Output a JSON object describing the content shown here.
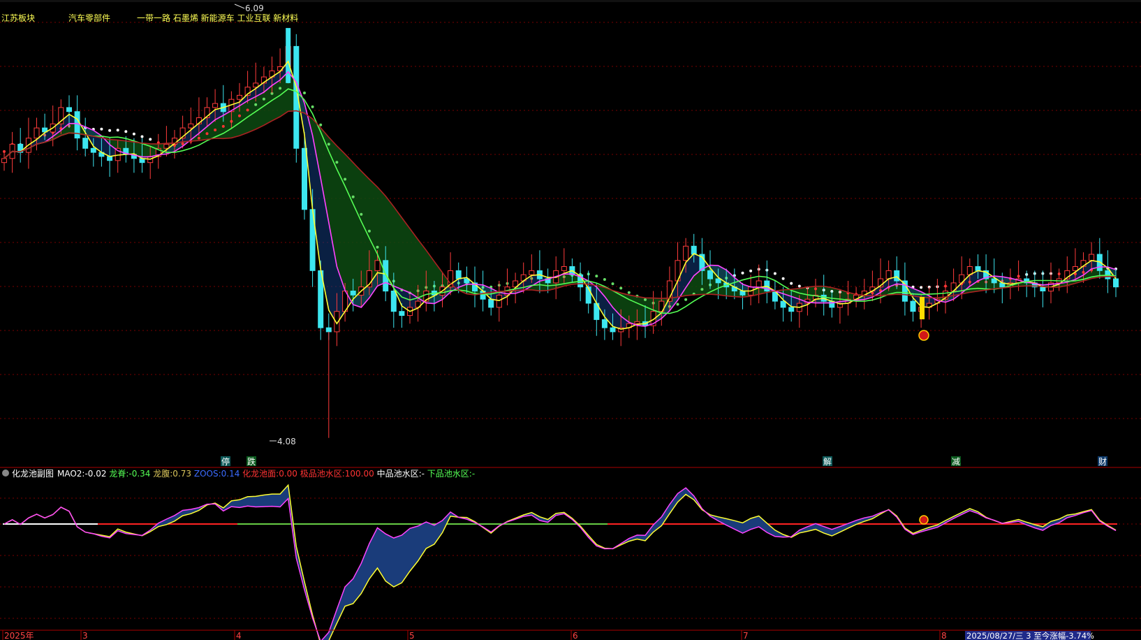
{
  "header": {
    "sectors": [
      "江苏板块",
      "汽车零部件",
      "一带一路 石墨烯 新能源车 工业互联 新材料"
    ]
  },
  "main_chart": {
    "high_label": "6.09",
    "low_label": "4.08",
    "event_tags": [
      "停",
      "跌",
      "解",
      "减",
      "财"
    ]
  },
  "sub_chart": {
    "title": "化龙池副图",
    "indicators": [
      {
        "label": "MAO2:",
        "value": "-0.02",
        "color": "#ffffff"
      },
      {
        "label": "龙脊:",
        "value": "-0.34",
        "color": "#55ff55"
      },
      {
        "label": "龙腹:",
        "value": "0.73",
        "color": "#d9c45a"
      },
      {
        "label": "ZOOS:",
        "value": "0.14",
        "color": "#3b6bff"
      },
      {
        "label": "化龙池面:",
        "value": "0.00",
        "color": "#ff3333"
      },
      {
        "label": "极品池水区:",
        "value": "100.00",
        "color": "#ff3333"
      },
      {
        "label": "中品池水区:",
        "value": "-",
        "color": "#ffffff"
      },
      {
        "label": "下品池水区:",
        "value": "-",
        "color": "#55ff55"
      }
    ]
  },
  "time_axis": {
    "labels": [
      "2025年",
      "3",
      "4",
      "5",
      "6",
      "7",
      "8"
    ],
    "status": "2025/08/27/三 3 至今涨幅-3.74%"
  },
  "chart_data": [
    {
      "type": "candlestick",
      "title": "",
      "ylabel": "",
      "xlabel": "",
      "high": 6.09,
      "low": 4.08,
      "ylim": [
        4.0,
        6.2
      ],
      "x_labels": [
        "2025年",
        "3",
        "4",
        "5",
        "6",
        "7",
        "8"
      ],
      "closes": [
        5.45,
        5.52,
        5.48,
        5.55,
        5.6,
        5.58,
        5.62,
        5.7,
        5.68,
        5.55,
        5.5,
        5.48,
        5.46,
        5.44,
        5.5,
        5.47,
        5.45,
        5.43,
        5.46,
        5.5,
        5.52,
        5.55,
        5.6,
        5.62,
        5.65,
        5.7,
        5.72,
        5.68,
        5.74,
        5.76,
        5.8,
        5.82,
        5.85,
        5.88,
        5.9,
        6.0,
        5.5,
        5.2,
        4.9,
        4.62,
        4.6,
        4.7,
        4.8,
        4.78,
        4.82,
        4.9,
        4.95,
        4.8,
        4.7,
        4.68,
        4.72,
        4.75,
        4.8,
        4.78,
        4.82,
        4.9,
        4.86,
        4.84,
        4.8,
        4.76,
        4.72,
        4.78,
        4.82,
        4.85,
        4.88,
        4.9,
        4.86,
        4.84,
        4.9,
        4.92,
        4.88,
        4.82,
        4.74,
        4.66,
        4.62,
        4.6,
        4.62,
        4.64,
        4.65,
        4.63,
        4.7,
        4.75,
        4.85,
        4.95,
        5.02,
        4.98,
        4.9,
        4.86,
        4.84,
        4.82,
        4.8,
        4.78,
        4.82,
        4.85,
        4.8,
        4.75,
        4.72,
        4.7,
        4.74,
        4.76,
        4.78,
        4.75,
        4.72,
        4.74,
        4.76,
        4.78,
        4.8,
        4.82,
        4.86,
        4.9,
        4.85,
        4.75,
        4.7,
        4.72,
        4.74,
        4.76,
        4.8,
        4.84,
        4.88,
        4.92,
        4.9,
        4.86,
        4.84,
        4.82,
        4.84,
        4.86,
        4.84,
        4.82,
        4.8,
        4.84,
        4.86,
        4.9,
        4.92,
        4.95,
        4.98,
        4.9,
        4.86,
        4.82
      ],
      "series": [
        {
          "name": "MAO2",
          "value": -0.02
        },
        {
          "name": "龙脊",
          "value": -0.34
        },
        {
          "name": "龙腹",
          "value": 0.73
        },
        {
          "name": "ZOOS",
          "value": 0.14
        },
        {
          "name": "化龙池面",
          "value": 0.0
        },
        {
          "name": "极品池水区",
          "value": 100.0
        }
      ]
    }
  ]
}
